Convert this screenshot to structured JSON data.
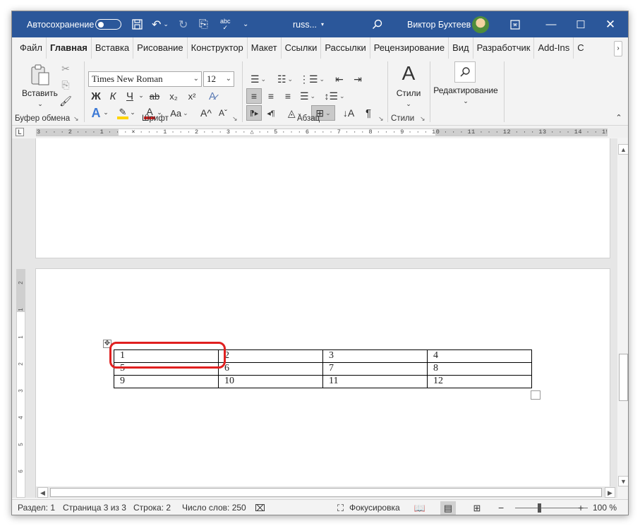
{
  "titlebar": {
    "autosave_label": "Автосохранение",
    "doc_title": "russ...",
    "user_name": "Виктор Бухтеев",
    "icons": [
      "save-icon",
      "undo-icon",
      "redo-icon",
      "touch-mode-icon",
      "spelling-icon",
      "customize-icon",
      "search-icon",
      "ribbon-display-icon",
      "minimize-icon",
      "maximize-icon",
      "close-icon"
    ]
  },
  "tabs": [
    {
      "label": "Файл"
    },
    {
      "label": "Главная",
      "active": true
    },
    {
      "label": "Вставка"
    },
    {
      "label": "Рисование"
    },
    {
      "label": "Конструктор"
    },
    {
      "label": "Макет"
    },
    {
      "label": "Ссылки"
    },
    {
      "label": "Рассылки"
    },
    {
      "label": "Рецензирование"
    },
    {
      "label": "Вид"
    },
    {
      "label": "Разработчик"
    },
    {
      "label": "Add-Ins"
    },
    {
      "label": "С"
    }
  ],
  "ribbon": {
    "clipboard": {
      "paste_label": "Вставить",
      "group_label": "Буфер обмена"
    },
    "font": {
      "font_name": "Times New Roman",
      "font_size": "12",
      "group_label": "Шрифт",
      "bold": "Ж",
      "italic": "К",
      "underline": "Ч",
      "strike": "ab",
      "subscript": "x₂",
      "superscript": "x²",
      "grow": "A^",
      "shrink": "Aˇ",
      "case": "Aa"
    },
    "paragraph": {
      "group_label": "Абзац",
      "pilcrow": "¶"
    },
    "styles": {
      "styles_label": "Стили",
      "group_label": "Стили"
    },
    "editing": {
      "editing_label": "Редактирование"
    }
  },
  "ruler": {
    "text": "3 · · · 2 · · · 1 · · · ⨯ · · · 1 · · · 2 · · · 3 · · △ · · 5 · · · 6 · · · 7 · · · 8 · · · 9 · · · 10 · · · 11 · · · 12 · · · 13 · · · 14 · · 15 · · 16 · · · 17 · · · 18 ·"
  },
  "vertical_ruler": [
    "2",
    "1",
    "1",
    "2",
    "3",
    "4",
    "5",
    "6"
  ],
  "table": {
    "rows": [
      [
        "1",
        "2",
        "3",
        "4"
      ],
      [
        "5",
        "6",
        "7",
        "8"
      ],
      [
        "9",
        "10",
        "11",
        "12"
      ]
    ]
  },
  "statusbar": {
    "section": "Раздел: 1",
    "page": "Страница 3 из 3",
    "line": "Строка: 2",
    "words": "Число слов: 250",
    "focus": "Фокусировка",
    "zoom_minus": "−",
    "zoom_plus": "+",
    "zoom": "100 %"
  },
  "colors": {
    "titlebar": "#2b579a",
    "highlight": "#e02020",
    "text_highlight": "#ffd400",
    "font_color": "#e02020"
  }
}
